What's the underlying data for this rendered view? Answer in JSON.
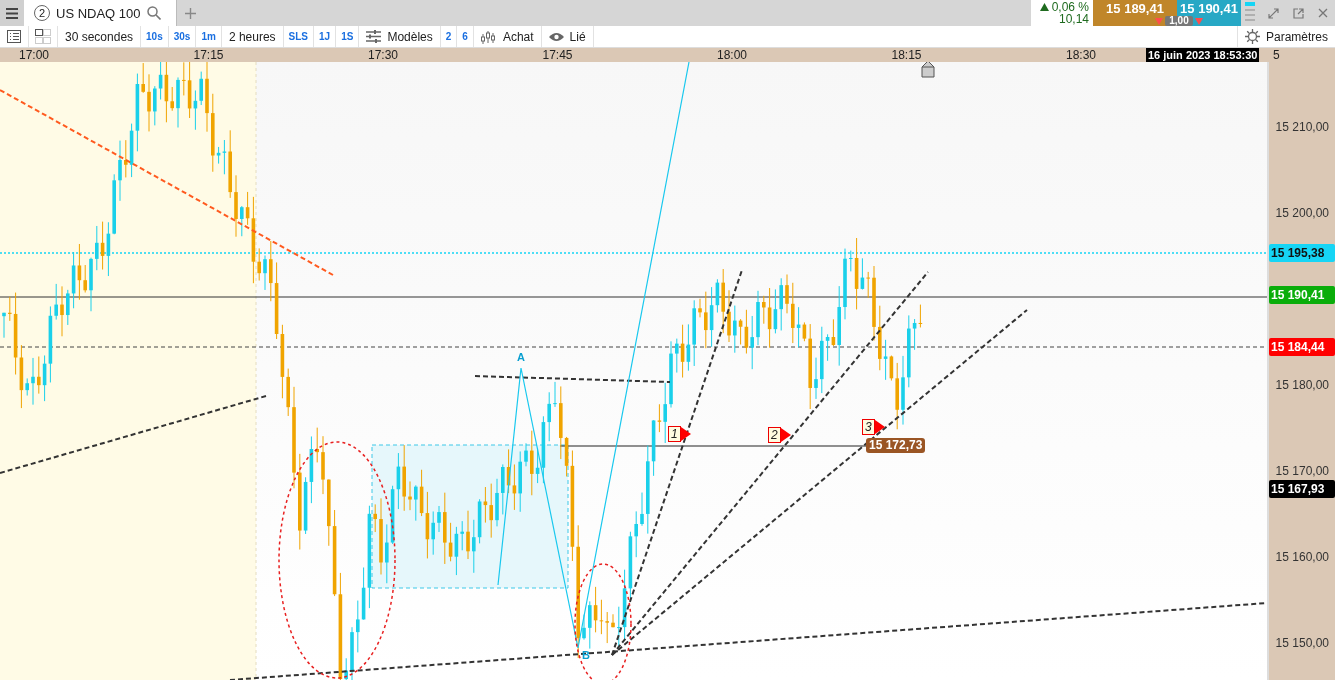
{
  "tab": {
    "number": "2",
    "title": "US NDAQ 100"
  },
  "quote": {
    "change": "0,06 %",
    "change_points": "10,14",
    "sell": "15 189,41",
    "buy": "15 190,41",
    "size": "1,00"
  },
  "toolbar": [
    {
      "kind": "list"
    },
    {
      "kind": "grid"
    },
    {
      "kind": "label",
      "text": "30 secondes"
    },
    {
      "kind": "quick",
      "text": "10s"
    },
    {
      "kind": "quick",
      "text": "30s"
    },
    {
      "kind": "quick",
      "text": "1m"
    },
    {
      "kind": "label",
      "text": "2 heures"
    },
    {
      "kind": "quick",
      "text": "SLS"
    },
    {
      "kind": "quick",
      "text": "1J"
    },
    {
      "kind": "quick",
      "text": "1S"
    },
    {
      "kind": "sliders",
      "text": "Modèles"
    },
    {
      "kind": "quick",
      "text": "2"
    },
    {
      "kind": "quick",
      "text": "6"
    },
    {
      "kind": "candles",
      "text": "Achat"
    },
    {
      "kind": "eye",
      "text": "Lié"
    }
  ],
  "settings": "Paramètres",
  "time_axis": {
    "labels": [
      "17:00",
      "17:15",
      "17:30",
      "17:45",
      "18:00",
      "18:15",
      "18:30"
    ],
    "cursor_time": "16 juin 2023 18:53:30",
    "cut_label": "5"
  },
  "price_axis": {
    "ticks": [
      "15 210,00",
      "15 200,00",
      "15 180,00",
      "15 170,00",
      "15 160,00",
      "15 150,00"
    ]
  },
  "price_tags": [
    {
      "text": "15 195,38",
      "color": "#16d5f5"
    },
    {
      "text": "15 190,41",
      "color": "#0aad0a"
    },
    {
      "text": "15 184,44",
      "color": "#ff0000"
    },
    {
      "text": "15 167,93",
      "color": "#000000"
    }
  ],
  "level_tag": {
    "text": "15 172,73",
    "color": "#9a5524"
  },
  "wave_labels": [
    "A",
    "B"
  ],
  "markers": [
    "1",
    "2",
    "3"
  ]
}
